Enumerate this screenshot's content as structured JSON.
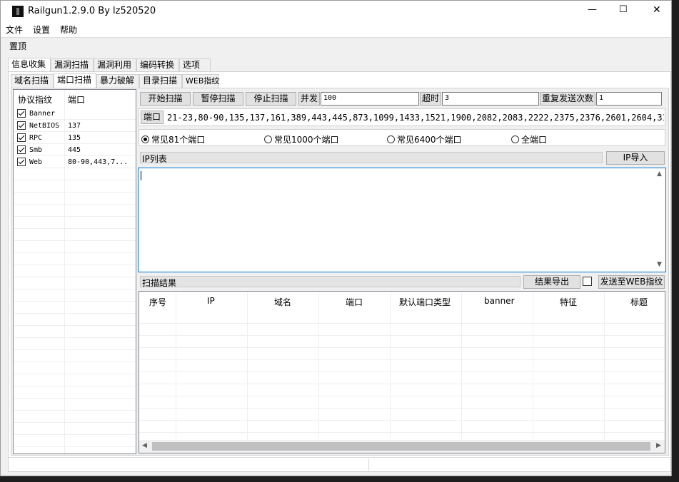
{
  "window": {
    "title": "Railgun1.2.9.0 By lz520520",
    "controls": [
      "—",
      "☐",
      "✕"
    ]
  },
  "menu": [
    "文件",
    "设置",
    "帮助"
  ],
  "pin_label": "置顶",
  "main_tabs": [
    "信息收集",
    "漏洞扫描",
    "漏洞利用",
    "编码转换",
    "选项"
  ],
  "sub_tabs": [
    "域名扫描",
    "端口扫描",
    "暴力破解",
    "目录扫描",
    "WEB指纹"
  ],
  "protocol_table": {
    "headers": [
      "协议指纹",
      "端口"
    ],
    "rows": [
      {
        "name": "Banner",
        "port": "",
        "checked": true
      },
      {
        "name": "NetBIOS",
        "port": "137",
        "checked": true
      },
      {
        "name": "RPC",
        "port": "135",
        "checked": true
      },
      {
        "name": "Smb",
        "port": "445",
        "checked": true
      },
      {
        "name": "Web",
        "port": "80-90,443,7...",
        "checked": true
      }
    ]
  },
  "toolbar": {
    "start": "开始扫描",
    "pause": "暂停扫描",
    "stop": "停止扫描",
    "concurrency_label": "并发",
    "concurrency_value": "100",
    "timeout_label": "超时",
    "timeout_value": "3",
    "retry_label": "重复发送次数",
    "retry_value": "1"
  },
  "port": {
    "label": "端口",
    "value": "21-23,80-90,135,137,161,389,443,445,873,1099,1433,1521,1900,2082,2083,2222,2375,2376,2601,2604,3128,3306,3311,3312,3"
  },
  "port_presets": [
    {
      "label": "常见81个端口",
      "selected": true
    },
    {
      "label": "常见1000个端口",
      "selected": false
    },
    {
      "label": "常见6400个端口",
      "selected": false
    },
    {
      "label": "全端口",
      "selected": false
    }
  ],
  "ip_list": {
    "label": "IP列表",
    "import_button": "IP导入",
    "value": ""
  },
  "results": {
    "label": "扫描结果",
    "export_button": "结果导出",
    "send_button": "发送至WEB指纹",
    "send_checked": false,
    "columns": [
      "序号",
      "IP",
      "域名",
      "端口",
      "默认端口类型",
      "banner",
      "特征",
      "标题"
    ]
  },
  "icons": {
    "app": "app-icon",
    "scroll_up": "chevron-up-icon",
    "scroll_down": "chevron-down-icon",
    "scroll_left": "chevron-left-icon",
    "scroll_right": "chevron-right-icon"
  },
  "colors": {
    "window_bg": "#f0f0f0",
    "focus_border": "#0078d7",
    "desktop_bg": "#1e1e1e"
  }
}
